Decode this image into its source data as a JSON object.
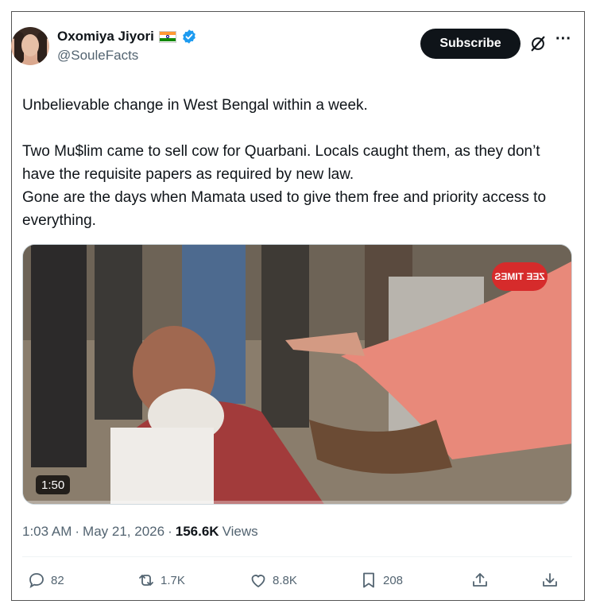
{
  "author": {
    "display_name": "Oxomiya Jiyori",
    "handle": "@SouleFacts",
    "flag_colors": [
      "#ff9933",
      "#ffffff",
      "#138808"
    ],
    "verified_color": "#1d9bf0"
  },
  "header": {
    "subscribe_label": "Subscribe",
    "grok_icon": "grok-icon",
    "more_icon": "more-icon",
    "more_glyph": "···"
  },
  "tweet": {
    "line1": "Unbelievable change in West Bengal within a week.",
    "line2": "Two Mu$lim came to sell cow for Quarbani. Locals caught them, as they don’t have the requisite papers as required by new law.",
    "line3": "Gone are the days when Mamata used to give them free and priority access to everything."
  },
  "media": {
    "duration": "1:50",
    "channel_logo": "ZEE TIMES"
  },
  "meta": {
    "time": "1:03 AM",
    "separator": "·",
    "date": "May 21, 2026",
    "views_count": "156.6K",
    "views_label": "Views"
  },
  "actions": {
    "replies": "82",
    "reposts": "1.7K",
    "likes": "8.8K",
    "bookmarks": "208"
  },
  "colors": {
    "text_primary": "#0f1419",
    "text_secondary": "#536471",
    "accent": "#1d9bf0"
  }
}
